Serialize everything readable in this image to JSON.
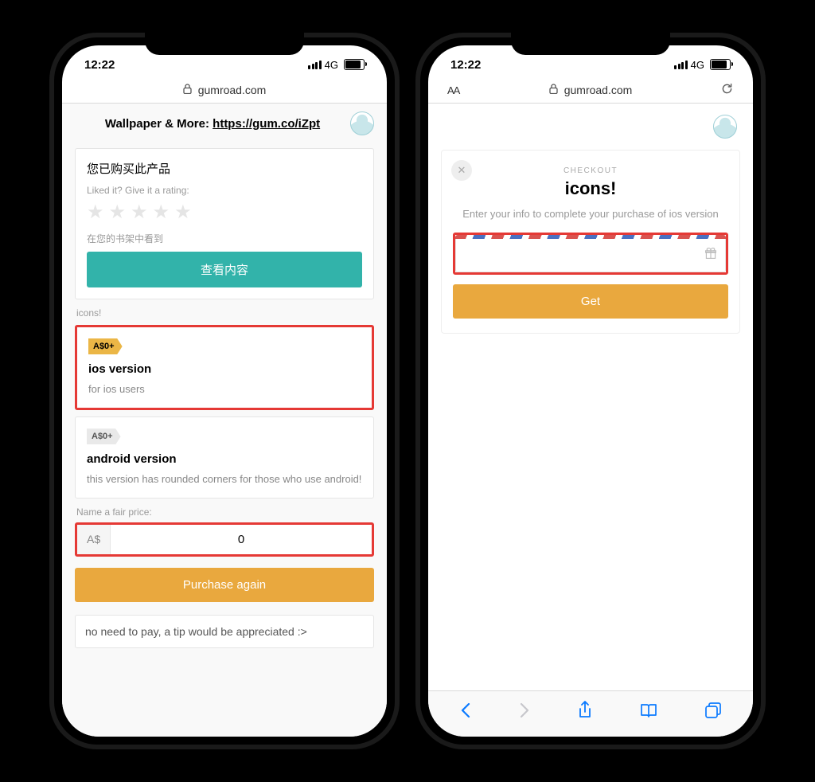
{
  "statusbar": {
    "time": "12:22",
    "network": "4G"
  },
  "urlbar": {
    "domain": "gumroad.com",
    "aa": "AA"
  },
  "left": {
    "header_prefix": "Wallpaper & More: ",
    "header_link": "https://gum.co/iZpt",
    "purchased_msg": "您已购买此产品",
    "rating_prompt": "Liked it? Give it a rating:",
    "shelf_note": "在您的书架中看到",
    "view_btn": "查看内容",
    "section_label": "icons!",
    "option_ios": {
      "price": "A$0+",
      "title": "ios version",
      "desc": "for ios users"
    },
    "option_android": {
      "price": "A$0+",
      "title": "android version",
      "desc": "this version has rounded corners for those who use android!"
    },
    "fair_price_label": "Name a fair price:",
    "currency_prefix": "A$",
    "price_value": "0",
    "purchase_btn": "Purchase again",
    "tip_text": "no need to pay, a tip would be appreciated :>"
  },
  "right": {
    "checkout_label": "CHECKOUT",
    "checkout_title": "icons!",
    "checkout_sub": "Enter your info to complete your purchase of ios version",
    "get_btn": "Get"
  }
}
